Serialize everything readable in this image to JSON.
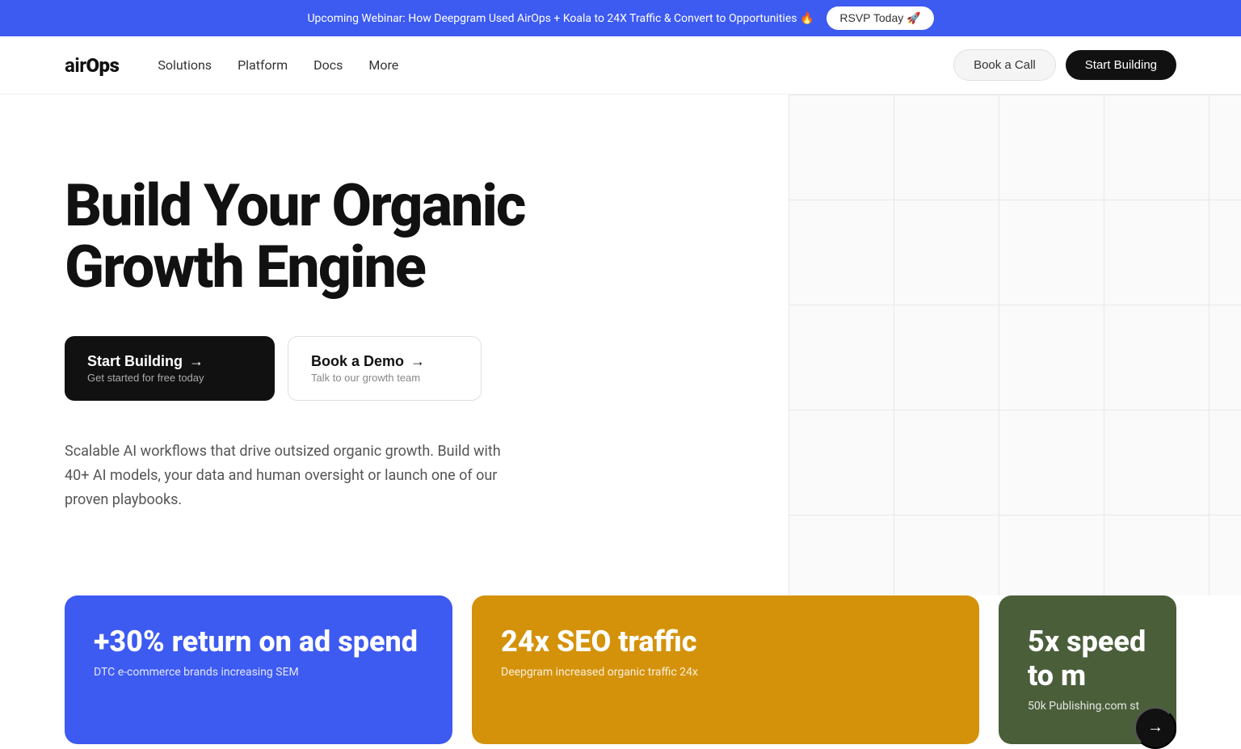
{
  "banner": {
    "text": "Upcoming Webinar: How Deepgram Used AirOps + Koala to 24X Traffic & Convert to Opportunities 🔥",
    "rsvp_label": "RSVP Today 🚀"
  },
  "nav": {
    "logo": "airOps",
    "links": [
      {
        "label": "Solutions",
        "href": "#"
      },
      {
        "label": "Platform",
        "href": "#"
      },
      {
        "label": "Docs",
        "href": "#"
      },
      {
        "label": "More",
        "href": "#"
      }
    ],
    "book_call": "Book a Call",
    "start_building": "Start Building"
  },
  "hero": {
    "title": "Build Your Organic Growth Engine",
    "start_building": {
      "title": "Start Building",
      "subtitle": "Get started for free today",
      "arrow": "→"
    },
    "book_demo": {
      "title": "Book a Demo",
      "subtitle": "Talk to our growth team",
      "arrow": "→"
    },
    "description": "Scalable AI workflows that drive outsized organic growth. Build with 40+ AI models, your data and human oversight or launch one of our proven playbooks."
  },
  "stats": [
    {
      "id": "blue",
      "color_class": "blue",
      "title": "+30% return on ad spend",
      "subtitle": "DTC e-commerce brands increasing SEM"
    },
    {
      "id": "amber",
      "color_class": "amber",
      "title": "24x SEO traffic",
      "subtitle": "Deepgram increased organic traffic 24x"
    },
    {
      "id": "green",
      "color_class": "green",
      "title": "5x speed to m",
      "subtitle": "50k Publishing.com st"
    }
  ],
  "next_arrow": "→"
}
